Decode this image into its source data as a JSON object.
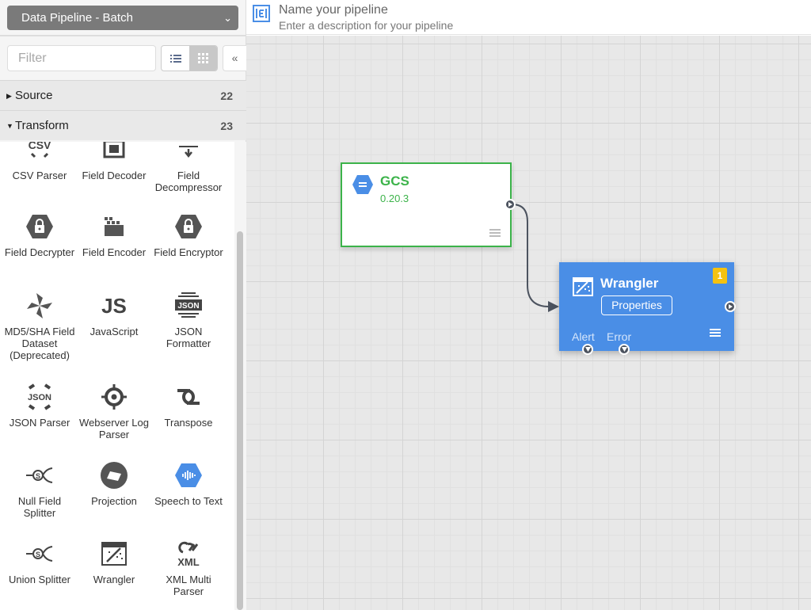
{
  "sidebar": {
    "pipeline_type": "Data Pipeline - Batch",
    "filter_placeholder": "Filter",
    "collapse_glyph": "«",
    "groups": [
      {
        "name": "Source",
        "count": "22",
        "expanded": false
      },
      {
        "name": "Transform",
        "count": "23",
        "expanded": true
      }
    ],
    "plugins": [
      {
        "label": "CSV Parser",
        "icon": "csv-icon"
      },
      {
        "label": "Field Decoder",
        "icon": "field-decoder-icon"
      },
      {
        "label": "Field Decompressor",
        "icon": "field-decompressor-icon"
      },
      {
        "label": "Field Decrypter",
        "icon": "lock-hexagon-icon"
      },
      {
        "label": "Field Encoder",
        "icon": "field-encoder-icon"
      },
      {
        "label": "Field Encryptor",
        "icon": "lock-hexagon-icon"
      },
      {
        "label": "MD5/SHA Field Dataset (Deprecated)",
        "icon": "pinwheel-icon"
      },
      {
        "label": "JavaScript",
        "icon": "js-icon"
      },
      {
        "label": "JSON Formatter",
        "icon": "json-formatter-icon"
      },
      {
        "label": "JSON Parser",
        "icon": "json-parser-icon"
      },
      {
        "label": "Webserver Log Parser",
        "icon": "crosshair-icon"
      },
      {
        "label": "Transpose",
        "icon": "transpose-icon"
      },
      {
        "label": "Null Field Splitter",
        "icon": "splitter-icon"
      },
      {
        "label": "Projection",
        "icon": "projection-icon"
      },
      {
        "label": "Speech to Text",
        "icon": "speech-hexagon-icon"
      },
      {
        "label": "Union Splitter",
        "icon": "splitter-icon"
      },
      {
        "label": "Wrangler",
        "icon": "wrangler-icon"
      },
      {
        "label": "XML Multi Parser",
        "icon": "xml-icon"
      }
    ]
  },
  "header": {
    "name_placeholder": "Name your pipeline",
    "description_placeholder": "Enter a description for your pipeline"
  },
  "canvas": {
    "nodes": {
      "gcs": {
        "name": "GCS",
        "version": "0.20.3"
      },
      "wrangler": {
        "name": "Wrangler",
        "properties_label": "Properties",
        "alert_label": "Alert",
        "error_label": "Error",
        "badge": "1"
      }
    }
  },
  "colors": {
    "source_green": "#3cb34a",
    "transform_blue": "#4a8ee6",
    "badge_yellow": "#f5c211"
  }
}
